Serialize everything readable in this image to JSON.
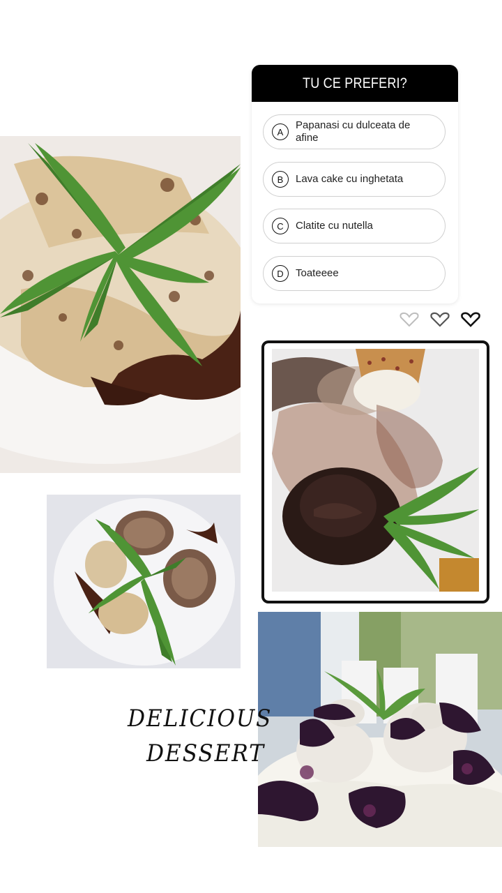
{
  "quiz": {
    "title": "TU CE PREFERI?",
    "options": [
      {
        "letter": "A",
        "label": "Papanasi cu dulceata de afine"
      },
      {
        "letter": "B",
        "label": "Lava cake cu inghetata"
      },
      {
        "letter": "C",
        "label": "Clatite cu nutella"
      },
      {
        "letter": "D",
        "label": "Toateeee"
      }
    ]
  },
  "caption": {
    "line1": "DELICIOUS",
    "line2": "DESSERT"
  },
  "photos": [
    {
      "name": "crepes-with-mint-photo"
    },
    {
      "name": "rolled-crepes-photo"
    },
    {
      "name": "lava-cake-with-ice-cream-photo"
    },
    {
      "name": "papanasi-with-blueberry-jam-photo"
    }
  ],
  "icons": [
    "heart-outline-icon",
    "heart-outline-icon",
    "heart-outline-icon"
  ],
  "colors": {
    "quiz_header": "#000000",
    "option_border": "#cfcfcf",
    "background": "#ffffff"
  }
}
